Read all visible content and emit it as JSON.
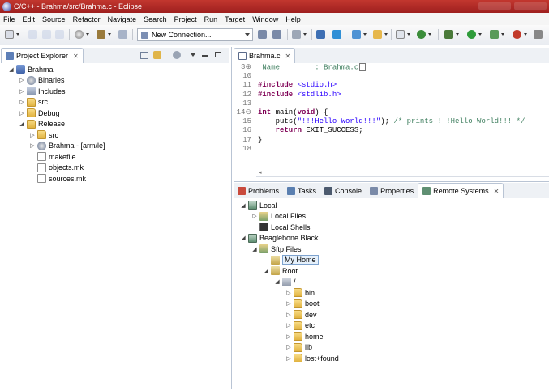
{
  "window": {
    "title": "C/C++ - Brahma/src/Brahma.c - Eclipse"
  },
  "menu": [
    "File",
    "Edit",
    "Source",
    "Refactor",
    "Navigate",
    "Search",
    "Project",
    "Run",
    "Target",
    "Window",
    "Help"
  ],
  "toolbar": {
    "connection_value": "New Connection..."
  },
  "project_explorer": {
    "tab_label": "Project Explorer",
    "items": [
      {
        "label": "Brahma",
        "depth": 0,
        "twisty": "◢",
        "icon": "project-icon"
      },
      {
        "label": "Binaries",
        "depth": 1,
        "twisty": "▷",
        "icon": "binaries-icon"
      },
      {
        "label": "Includes",
        "depth": 1,
        "twisty": "▷",
        "icon": "includes-icon"
      },
      {
        "label": "src",
        "depth": 1,
        "twisty": "▷",
        "icon": "folder-icon"
      },
      {
        "label": "Debug",
        "depth": 1,
        "twisty": "▷",
        "icon": "folder-icon"
      },
      {
        "label": "Release",
        "depth": 1,
        "twisty": "◢",
        "icon": "folder-icon"
      },
      {
        "label": "src",
        "depth": 2,
        "twisty": "▷",
        "icon": "folder-icon"
      },
      {
        "label": "Brahma - [arm/le]",
        "depth": 2,
        "twisty": "▷",
        "icon": "binary-icon"
      },
      {
        "label": "makefile",
        "depth": 2,
        "twisty": "",
        "icon": "file-icon"
      },
      {
        "label": "objects.mk",
        "depth": 2,
        "twisty": "",
        "icon": "file-icon"
      },
      {
        "label": "sources.mk",
        "depth": 2,
        "twisty": "",
        "icon": "file-icon"
      }
    ]
  },
  "editor": {
    "tab_label": "Brahma.c",
    "lines": [
      {
        "n": "3⊕",
        "parts": [
          {
            "t": " Name        : Brahma.c",
            "c": "cm"
          }
        ]
      },
      {
        "n": "10",
        "parts": []
      },
      {
        "n": "11",
        "parts": [
          {
            "t": "#include ",
            "c": "kw"
          },
          {
            "t": "<stdio.h>",
            "c": "str"
          }
        ]
      },
      {
        "n": "12",
        "parts": [
          {
            "t": "#include ",
            "c": "kw"
          },
          {
            "t": "<stdlib.h>",
            "c": "str"
          }
        ]
      },
      {
        "n": "13",
        "parts": []
      },
      {
        "n": "14⊖",
        "parts": [
          {
            "t": "int ",
            "c": "kw"
          },
          {
            "t": "main(",
            "c": ""
          },
          {
            "t": "void",
            "c": "kw"
          },
          {
            "t": ") {",
            "c": ""
          }
        ]
      },
      {
        "n": "15",
        "parts": [
          {
            "t": "    puts(",
            "c": ""
          },
          {
            "t": "\"!!!Hello World!!!\"",
            "c": "str"
          },
          {
            "t": "); ",
            "c": ""
          },
          {
            "t": "/* prints !!!Hello World!!! */",
            "c": "cm"
          }
        ]
      },
      {
        "n": "16",
        "parts": [
          {
            "t": "    ",
            "c": ""
          },
          {
            "t": "return ",
            "c": "kw"
          },
          {
            "t": "EXIT_SUCCESS;",
            "c": ""
          }
        ]
      },
      {
        "n": "17",
        "parts": [
          {
            "t": "}",
            "c": ""
          }
        ]
      },
      {
        "n": "18",
        "parts": []
      }
    ]
  },
  "bottom_tabs": [
    {
      "label": "Problems",
      "icon": "problems-icon",
      "active": false
    },
    {
      "label": "Tasks",
      "icon": "tasks-icon",
      "active": false
    },
    {
      "label": "Console",
      "icon": "console-icon",
      "active": false
    },
    {
      "label": "Properties",
      "icon": "properties-icon",
      "active": false
    },
    {
      "label": "Remote Systems",
      "icon": "remote-systems-icon",
      "active": true
    }
  ],
  "remote_systems": {
    "items": [
      {
        "label": "Local",
        "depth": 0,
        "twisty": "◢",
        "icon": "host-icon"
      },
      {
        "label": "Local Files",
        "depth": 1,
        "twisty": "▷",
        "icon": "files-subsystem-icon"
      },
      {
        "label": "Local Shells",
        "depth": 1,
        "twisty": "",
        "icon": "shells-icon"
      },
      {
        "label": "Beaglebone Black",
        "depth": 0,
        "twisty": "◢",
        "icon": "host-icon"
      },
      {
        "label": "Sftp Files",
        "depth": 1,
        "twisty": "◢",
        "icon": "files-subsystem-icon"
      },
      {
        "label": "My Home",
        "depth": 2,
        "twisty": "",
        "icon": "filter-icon",
        "selected": true
      },
      {
        "label": "Root",
        "depth": 2,
        "twisty": "◢",
        "icon": "filter-icon"
      },
      {
        "label": "/",
        "depth": 3,
        "twisty": "◢",
        "icon": "root-drive-icon"
      },
      {
        "label": "bin",
        "depth": 4,
        "twisty": "▷",
        "icon": "folder-icon"
      },
      {
        "label": "boot",
        "depth": 4,
        "twisty": "▷",
        "icon": "folder-icon"
      },
      {
        "label": "dev",
        "depth": 4,
        "twisty": "▷",
        "icon": "folder-icon"
      },
      {
        "label": "etc",
        "depth": 4,
        "twisty": "▷",
        "icon": "folder-icon"
      },
      {
        "label": "home",
        "depth": 4,
        "twisty": "▷",
        "icon": "folder-icon"
      },
      {
        "label": "lib",
        "depth": 4,
        "twisty": "▷",
        "icon": "folder-icon"
      },
      {
        "label": "lost+found",
        "depth": 4,
        "twisty": "▷",
        "icon": "folder-icon"
      }
    ]
  },
  "colors": {
    "title_bar": "#b02a27",
    "chrome": "#eef1f5",
    "border": "#b9c4d4",
    "keyword": "#7f0055",
    "string": "#2a00ff",
    "comment": "#3f7f5f"
  }
}
